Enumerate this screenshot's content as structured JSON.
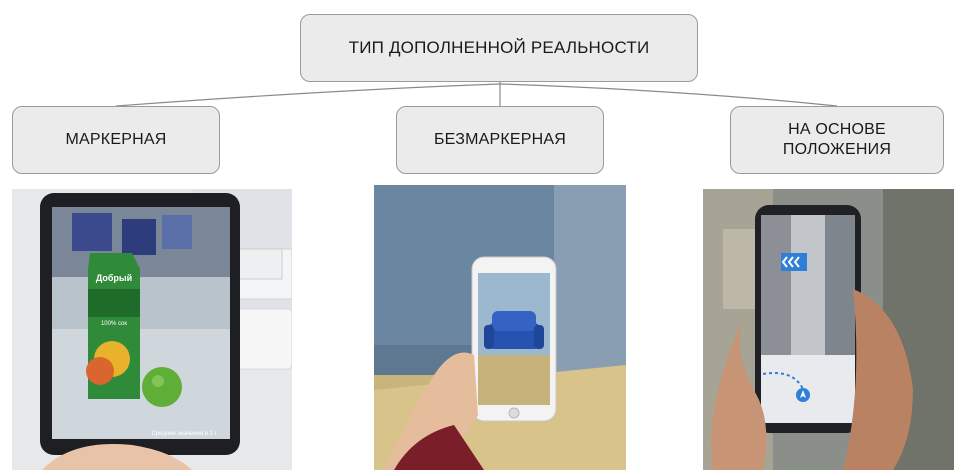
{
  "root": {
    "label": "ТИП ДОПОЛНЕННОЙ РЕАЛЬНОСТИ"
  },
  "branches": [
    {
      "label": "МАРКЕРНАЯ"
    },
    {
      "label": "БЕЗМАРКЕРНАЯ"
    },
    {
      "label": "НА ОСНОВЕ ПОЛОЖЕНИЯ"
    }
  ],
  "photos": [
    {
      "icon": "tablet-marker-ar-photo",
      "overlay_text": [
        "Добрый",
        "100% сок"
      ],
      "footnote": "Средние значения в 1 г"
    },
    {
      "icon": "phone-markerless-ar-photo"
    },
    {
      "icon": "phone-location-ar-photo"
    }
  ],
  "colors": {
    "node_fill": "#ebebeb",
    "node_border": "#9a9a9a",
    "line": "#8a8a8a"
  }
}
